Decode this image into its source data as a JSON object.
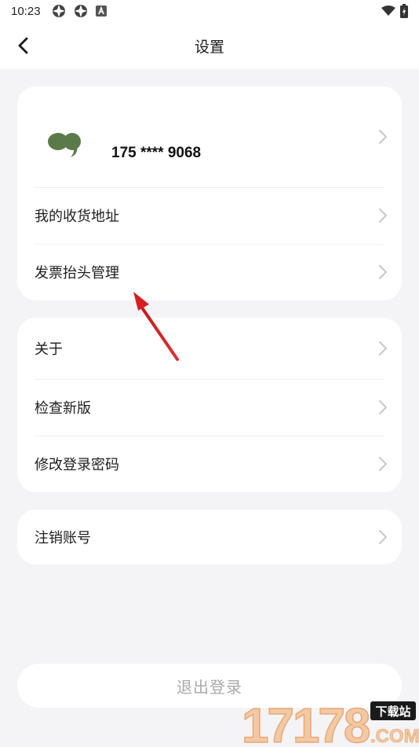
{
  "status_bar": {
    "time": "10:23",
    "notification_icons": [
      "app-icon",
      "app-icon",
      "a-badge-icon"
    ],
    "right_icons": [
      "wifi-icon",
      "battery-charging-icon"
    ]
  },
  "header": {
    "title": "设置",
    "back_icon": "chevron-left-icon"
  },
  "profile": {
    "avatar_icon": "quote-bubble-avatar",
    "avatar_color": "#5b7a4a",
    "phone": "175 **** 9068"
  },
  "group1": {
    "items": [
      {
        "label": "我的收货地址"
      },
      {
        "label": "发票抬头管理"
      }
    ]
  },
  "group2": {
    "items": [
      {
        "label": "关于"
      },
      {
        "label": "检查新版"
      },
      {
        "label": "修改登录密码"
      }
    ]
  },
  "group3": {
    "items": [
      {
        "label": "注销账号"
      }
    ]
  },
  "logout": {
    "label": "退出登录"
  },
  "annotation": {
    "arrow_color": "#d62020"
  },
  "watermark": {
    "brand": "17178",
    "tag": "下载站",
    "domain": ".COM"
  }
}
